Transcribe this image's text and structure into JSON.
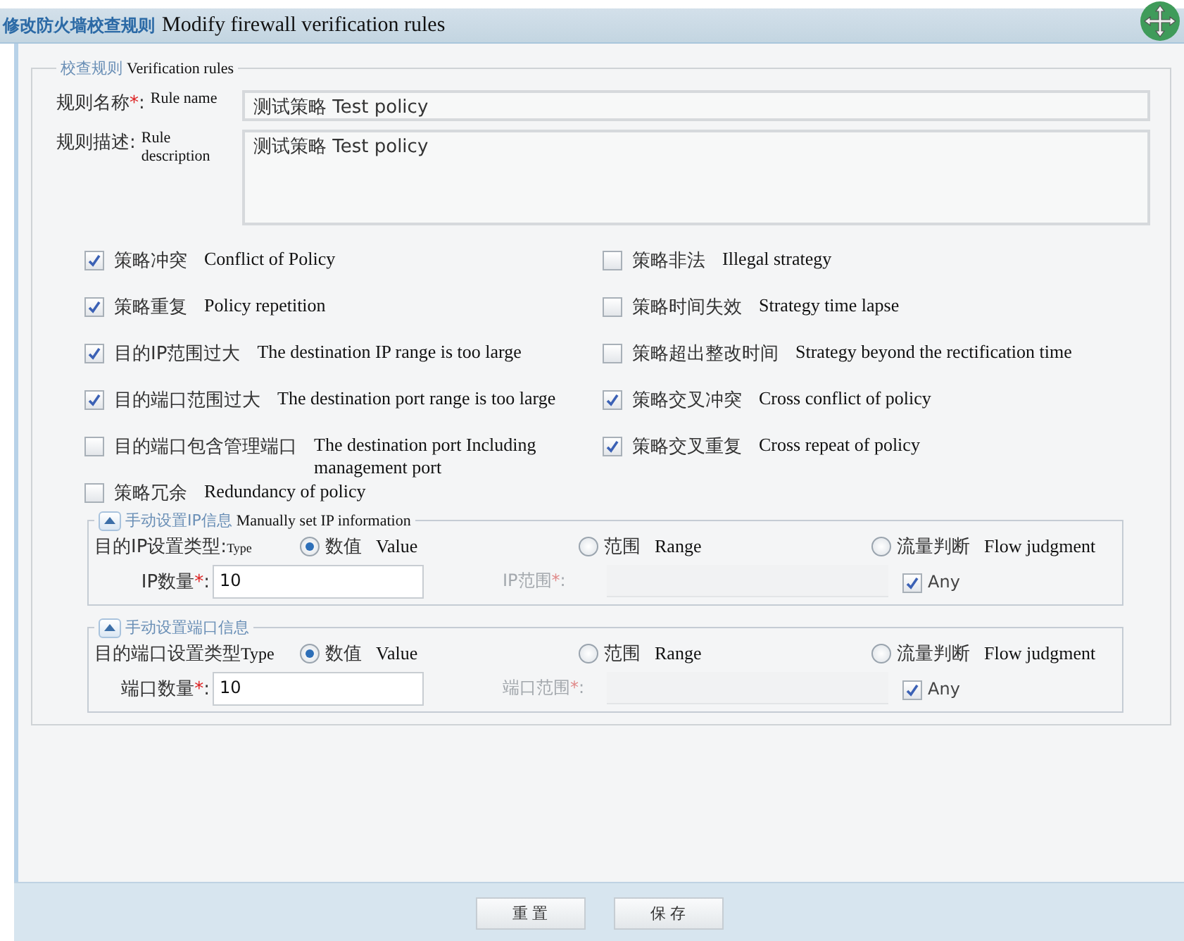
{
  "window": {
    "title": "修改防火墙校查规则",
    "title_translation": "Modify firewall verification rules"
  },
  "rules_section": {
    "legend": "校查规则",
    "legend_translation": "Verification rules",
    "name_field": {
      "label": "规则名称",
      "mark": "*",
      "suffix": ":",
      "label_translation": "Rule name",
      "value": "测试策略 Test policy"
    },
    "description_field": {
      "label": "规则描述:",
      "label_translation": "Rule description",
      "value": "测试策略 Test policy"
    },
    "checks_left": [
      {
        "label": "策略冲突",
        "translation": "Conflict of Policy",
        "checked": true
      },
      {
        "label": "策略重复",
        "translation": "Policy repetition",
        "checked": true
      },
      {
        "label": "目的IP范围过大",
        "translation": "The destination IP range is too large",
        "checked": true
      },
      {
        "label": "目的端口范围过大",
        "translation": "The destination port  range is too large",
        "checked": true
      },
      {
        "label": "目的端口包含管理端口",
        "translation": "The destination port  Including management port",
        "checked": false
      },
      {
        "label": "策略冗余",
        "translation": "Redundancy of policy",
        "checked": false
      }
    ],
    "checks_right": [
      {
        "label": "策略非法",
        "translation": "Illegal strategy",
        "checked": false
      },
      {
        "label": "策略时间失效",
        "translation": "Strategy time lapse",
        "checked": false
      },
      {
        "label": "策略超出整改时间",
        "translation": "Strategy beyond the rectification time",
        "checked": false
      },
      {
        "label": "策略交叉冲突",
        "translation": "Cross conflict of policy",
        "checked": true
      },
      {
        "label": "策略交叉重复",
        "translation": "Cross repeat of policy",
        "checked": true
      }
    ]
  },
  "ip_group": {
    "legend": "手动设置IP信息",
    "legend_translation": "Manually set IP information",
    "expanded": true,
    "type_label": "目的IP设置类型:",
    "type_translation": "Type",
    "options": [
      {
        "label": "数值",
        "translation": "Value",
        "selected": true
      },
      {
        "label": "范围",
        "translation": "Range",
        "selected": false
      },
      {
        "label": "流量判断",
        "translation": "Flow judgment",
        "selected": false
      }
    ],
    "count_field": {
      "label": "IP数量",
      "mark": "*",
      "suffix": ":",
      "value": "10"
    },
    "range_field": {
      "label": "IP范围",
      "mark": "*",
      "suffix": ":",
      "disabled": true
    },
    "any": {
      "label": "Any",
      "checked": true
    }
  },
  "port_group": {
    "legend": "手动设置端口信息",
    "expanded": true,
    "type_label": "目的端口设置类型",
    "type_translation": "Type",
    "options": [
      {
        "label": "数值",
        "translation": "Value",
        "selected": true
      },
      {
        "label": "范围",
        "translation": "Range",
        "selected": false
      },
      {
        "label": "流量判断",
        "translation": "Flow judgment",
        "selected": false
      }
    ],
    "count_field": {
      "label": "端口数量",
      "mark": "*",
      "suffix": ":",
      "value": "10"
    },
    "range_field": {
      "label": "端口范围",
      "mark": "*",
      "suffix": ":",
      "disabled": true
    },
    "any": {
      "label": "Any",
      "checked": true
    }
  },
  "buttons": [
    {
      "label": "重 置"
    },
    {
      "label": "保 存"
    }
  ]
}
